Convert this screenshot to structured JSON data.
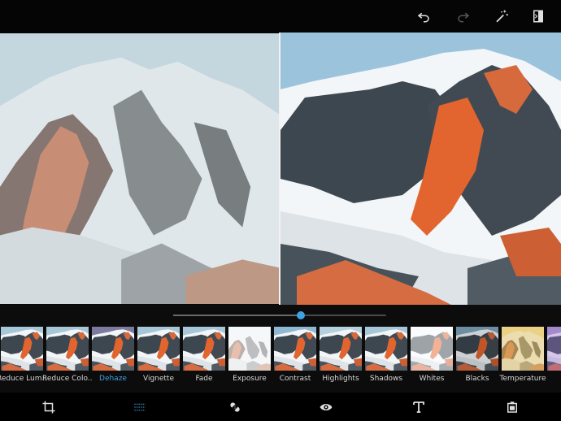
{
  "toolbar": {
    "icons": [
      "undo-icon",
      "redo-icon",
      "auto-fix-wand-icon",
      "compare-icon"
    ]
  },
  "editor": {
    "mode": "split-before-after"
  },
  "slider": {
    "value": 0.6
  },
  "filters": [
    {
      "label": "Reduce Lum..."
    },
    {
      "label": "Reduce Colo..."
    },
    {
      "label": "Dehaze",
      "selected": true
    },
    {
      "label": "Vignette"
    },
    {
      "label": "Fade"
    },
    {
      "label": "Exposure"
    },
    {
      "label": "Contrast"
    },
    {
      "label": "Highlights"
    },
    {
      "label": "Shadows"
    },
    {
      "label": "Whites"
    },
    {
      "label": "Blacks"
    },
    {
      "label": "Temperature"
    }
  ],
  "bottom_tools": {
    "icons": [
      "crop-icon",
      "adjustments-icon",
      "bandage-icon",
      "eye-icon",
      "text-icon",
      "frame-icon"
    ],
    "selected": "adjustments-icon"
  },
  "colors": {
    "accent": "#3ea3e0",
    "background": "#000000",
    "sky_before": "#c3d6df",
    "sky_after": "#9bc4dc",
    "rock_glow": "#e7653c"
  }
}
